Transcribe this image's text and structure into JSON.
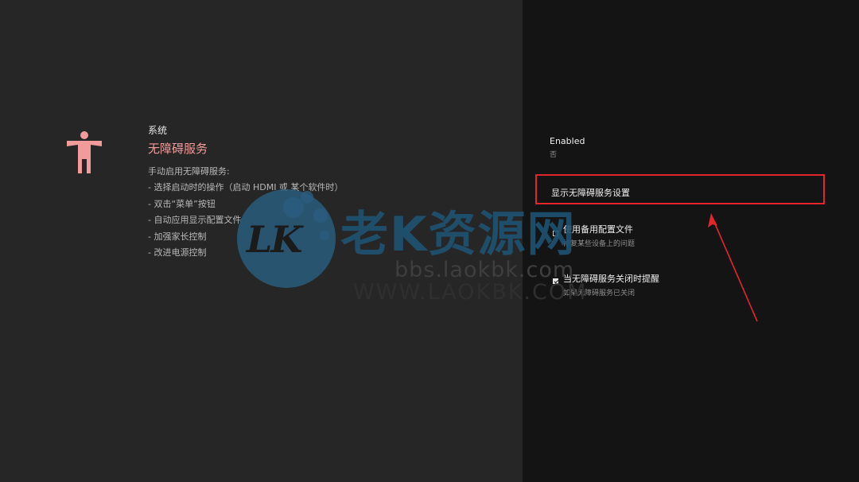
{
  "header": {
    "breadcrumb": "系统",
    "title": "无障碍服务"
  },
  "description": {
    "lines": [
      "手动启用无障碍服务:",
      "- 选择启动时的操作（启动 HDMI 或 某个软件时）",
      " - 双击“菜单”按钮",
      " - 自动应用显示配置文件",
      " - 加强家长控制",
      " - 改进电源控制"
    ]
  },
  "settings": {
    "enabled": {
      "title": "Enabled",
      "value": "否"
    },
    "show_settings": {
      "title": "显示无障碍服务设置"
    },
    "backup_profile": {
      "title": "使用备用配置文件",
      "subtitle": "修复某些设备上的问题",
      "checked": false
    },
    "notify_off": {
      "title": "当无障碍服务关闭时提醒",
      "subtitle": "如果无障碍服务已关闭",
      "checked": true
    }
  },
  "watermark": {
    "logo": "LK",
    "brand": "老K资源网",
    "url": "bbs.laokbk.com",
    "www": "WWW.LAOKBK.COM"
  },
  "colors": {
    "accent": "#f19b9b",
    "focus_border": "#e3262b",
    "left_bg": "#262626",
    "right_bg": "#141414"
  },
  "icons": {
    "header": "accessibility-person-icon",
    "annotation": "red-arrow"
  }
}
